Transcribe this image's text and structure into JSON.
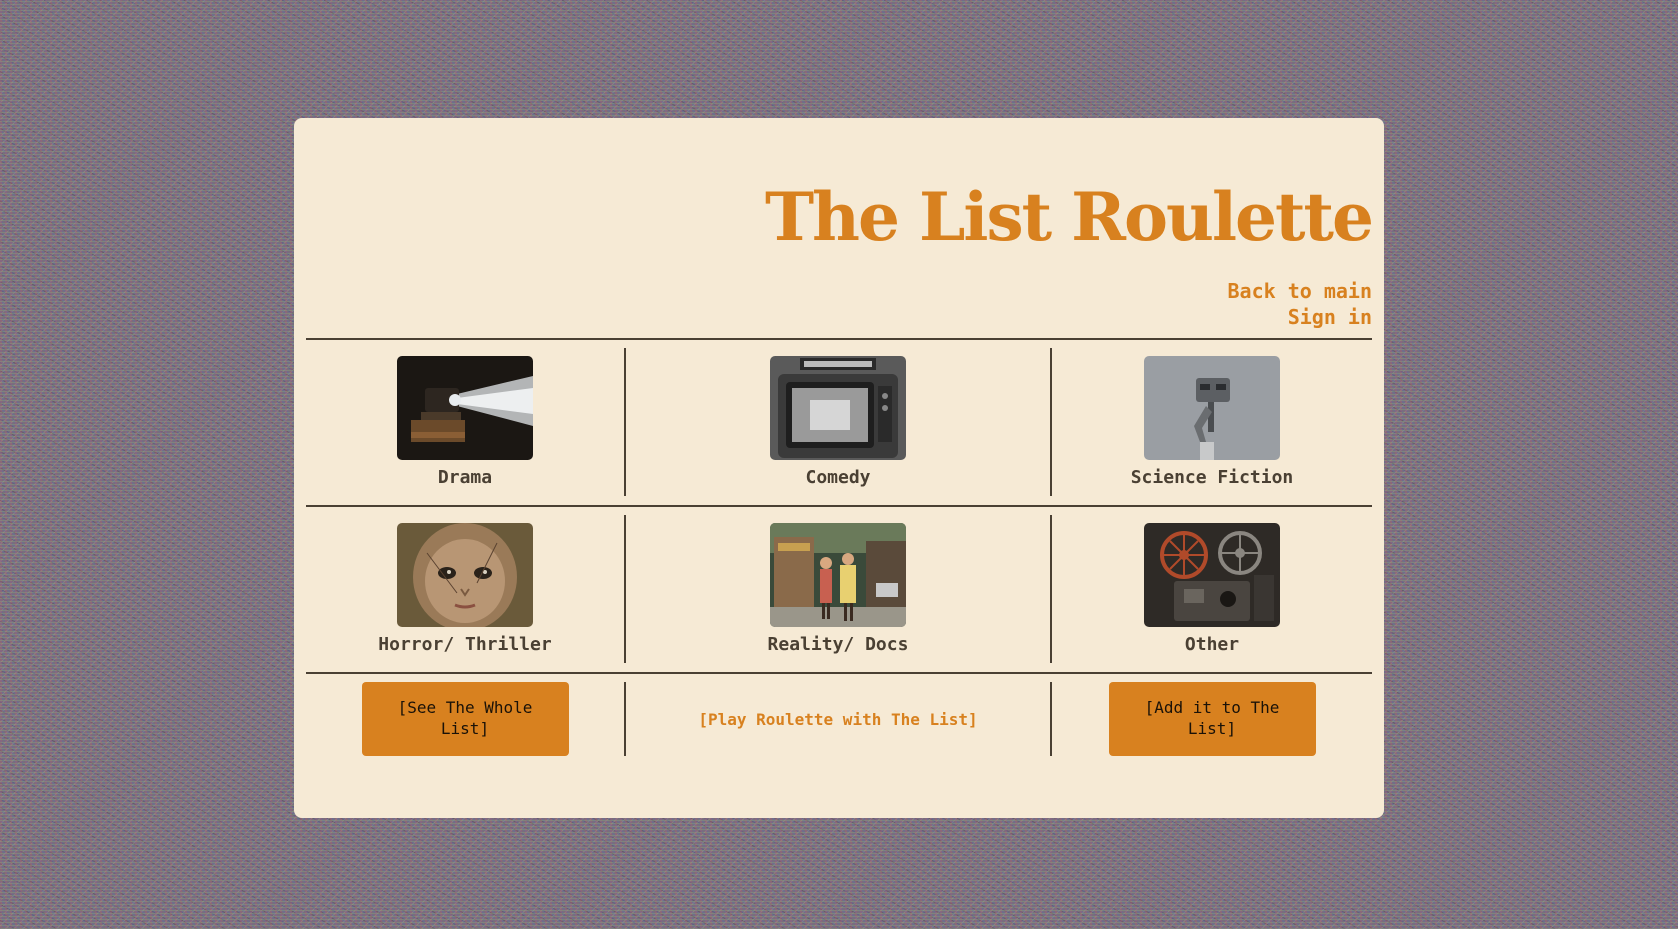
{
  "header": {
    "title": "The List Roulette",
    "back_link": "Back to main",
    "signin_link": "Sign in"
  },
  "genres": [
    {
      "label": "Drama",
      "icon": "film-projector-image"
    },
    {
      "label": "Comedy",
      "icon": "vintage-tv-image"
    },
    {
      "label": "Science Fiction",
      "icon": "robot-walker-image"
    },
    {
      "label": "Horror/ Thriller",
      "icon": "doll-face-image"
    },
    {
      "label": "Reality/ Docs",
      "icon": "street-scene-image"
    },
    {
      "label": "Other",
      "icon": "film-reels-image"
    }
  ],
  "actions": {
    "see_list": "[See The Whole List]",
    "play": "[Play Roulette with The List]",
    "add": "[Add it to The List]"
  },
  "colors": {
    "accent": "#d8811f",
    "card": "#f6ead5",
    "text": "#4a4033"
  }
}
